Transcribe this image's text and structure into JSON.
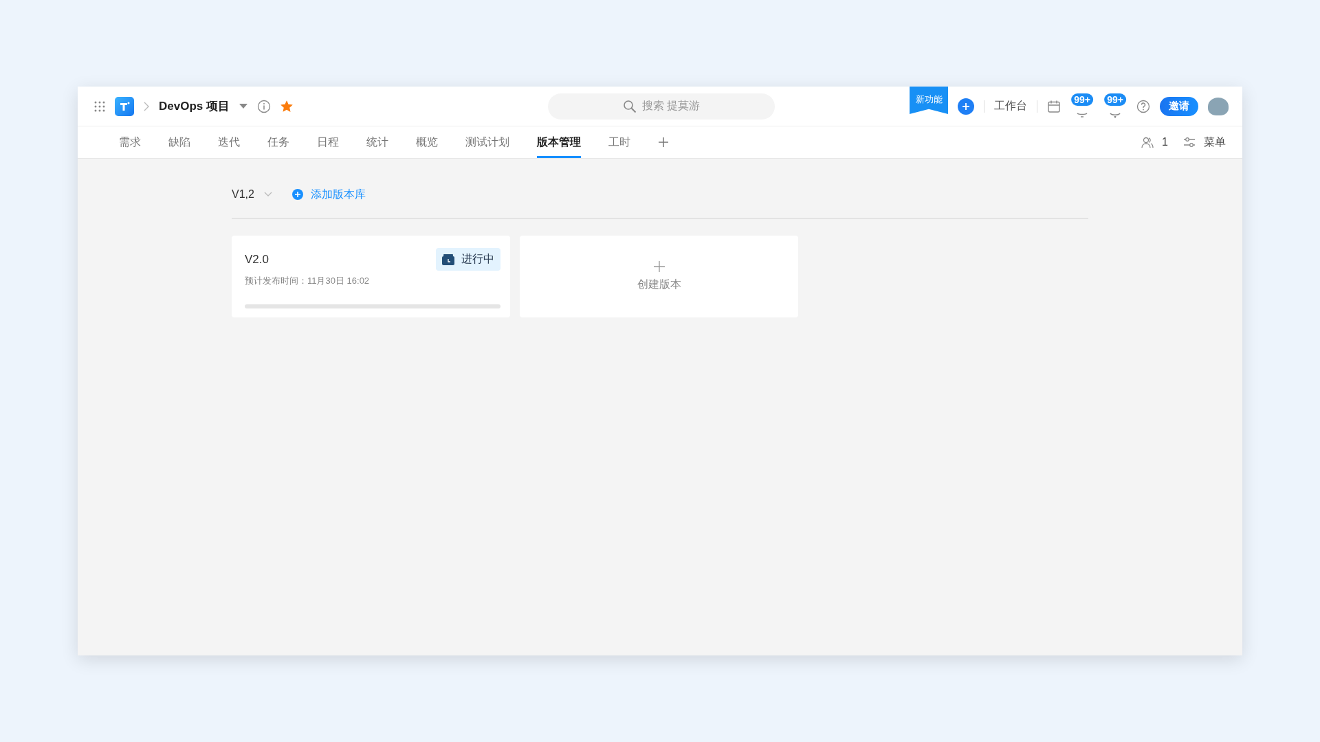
{
  "header": {
    "project": "DevOps 项目",
    "starred": true,
    "search": {
      "placeholder": "搜索 提莫游"
    },
    "new_feature": "新功能",
    "workbench": "工作台",
    "notifications": "99+",
    "messages": "99+",
    "invite": "邀请"
  },
  "tabs": [
    {
      "label": "需求",
      "selected": false
    },
    {
      "label": "缺陷",
      "selected": false
    },
    {
      "label": "迭代",
      "selected": false
    },
    {
      "label": "任务",
      "selected": false
    },
    {
      "label": "日程",
      "selected": false
    },
    {
      "label": "统计",
      "selected": false
    },
    {
      "label": "概览",
      "selected": false
    },
    {
      "label": "测试计划",
      "selected": false
    },
    {
      "label": "版本管理",
      "selected": true
    },
    {
      "label": "工时",
      "selected": false
    }
  ],
  "members": "1",
  "menu": "菜单",
  "library": {
    "name": "V1,2",
    "add": "添加版本库"
  },
  "versions": [
    {
      "name": "V2.0",
      "status": "进行中",
      "release": "预计发布时间：11月30日 16:02",
      "level": 0
    }
  ],
  "create": "创建版本"
}
